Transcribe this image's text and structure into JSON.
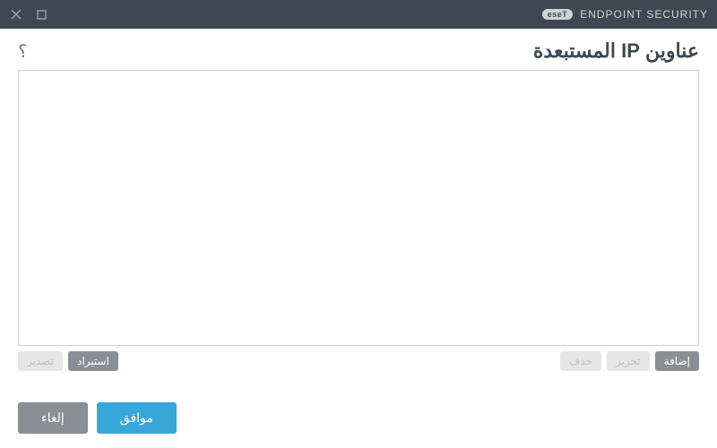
{
  "titlebar": {
    "brand_badge": "eseT",
    "brand_text": "ENDPOINT SECURITY"
  },
  "header": {
    "title": "عناوين IP المستبعدة",
    "help": "؟"
  },
  "list_toolbar": {
    "add": "إضافة",
    "edit": "تحرير",
    "delete": "حذف",
    "import": "استيراد",
    "export": "تصدير"
  },
  "footer": {
    "ok": "موافق",
    "cancel": "إلغاء"
  }
}
